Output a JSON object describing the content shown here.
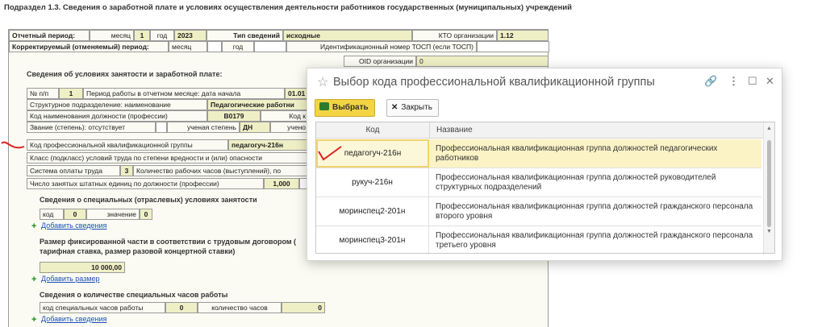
{
  "section_title": "Подраздел 1.3. Сведения о заработной плате и условиях осуществления деятельности работников государственных (муниципальных) учреждений",
  "header": {
    "period_label": "Отчетный период:",
    "month_label": "месяц",
    "month_value": "1",
    "year_label": "год",
    "year_value": "2023",
    "type_label": "Тип сведений",
    "type_value": "исходные",
    "kto_label": "КТО организации",
    "kto_value": "1.12",
    "corr_label": "Корректируемый (отменяемый) период:",
    "corr_month_label": "месяц",
    "corr_year_label": "год",
    "tosp_label": "Идентификационный номер ТОСП (если ТОСП)",
    "oid_label": "OID организации",
    "oid_value": "0"
  },
  "conditions": {
    "heading": "Сведения об условиях занятости и заработной плате:",
    "np_label": "№ п/п",
    "np_value": "1",
    "work_period_label": "Период работы в отчетном месяце:  дата начала",
    "work_period_start": "01.01",
    "struct_label": "Структурное подразделение:  наименование",
    "struct_value": "Педагогические работни",
    "position_code_label": "Код наименования должности (профессии)",
    "position_code_value": "B0179",
    "position_code_tail": "Код к",
    "rank_label": "Звание (степень):  отсутствует",
    "degree_label": "ученая степень",
    "degree_value": "ДН",
    "degree_tail": "учено",
    "pkg_label": "Код профессиональной квалификационной группы",
    "pkg_value": "педагогуч-216н",
    "class_label": "Класс (подкласс) условий труда по степени вредности и (или) опасности",
    "pay_system_label": "Система оплаты труда",
    "pay_system_value": "3",
    "hours_label": "Количество рабочих часов (выступлений), по",
    "staff_units_label": "Число занятых штатных единиц по должности (профессии)",
    "staff_units_value": "1,000"
  },
  "special_conditions": {
    "heading": "Сведения о специальных (отраслевых) условиях занятости",
    "code_label": "код",
    "code_value": "0",
    "value_label": "значение",
    "value_value": "0",
    "add_link": "Добавить сведения"
  },
  "fixed_part": {
    "heading_line1": "Размер фиксированной части в соответствии с трудовым договором (",
    "heading_line2": "тарифная ставка, размер разовой концертной ставки)",
    "value": "10 000,00",
    "add_link": "Добавить размер"
  },
  "special_hours": {
    "heading": "Сведения о количестве специальных часов работы",
    "code_label": "код специальных часов работы",
    "code_value": "0",
    "count_label": "количество часов",
    "count_value": "0",
    "add_link": "Добавить сведения"
  },
  "modal": {
    "title": "Выбор кода профессиональной квалификационной группы",
    "select_button": "Выбрать",
    "close_button": "Закрыть",
    "columns": {
      "code": "Код",
      "name": "Название"
    },
    "rows": [
      {
        "code": "педагогуч-216н",
        "name": "Профессиональная квалификационная группа должностей педагогических работников",
        "selected": true
      },
      {
        "code": "рукуч-216н",
        "name": "Профессиональная квалификационная группа должностей руководителей структурных подразделений",
        "selected": false
      },
      {
        "code": "моринспец2-201н",
        "name": "Профессиональная квалификационная группа должностей гражданского персонала второго уровня",
        "selected": false
      },
      {
        "code": "моринспец3-201н",
        "name": "Профессиональная квалификационная группа должностей гражданского персонала третьего уровня",
        "selected": false
      }
    ]
  },
  "icons": {
    "star": "star-icon",
    "link": "link-icon",
    "menu": "more-vertical-icon",
    "maximize": "maximize-icon",
    "close": "close-icon"
  },
  "colors": {
    "accent_yellow": "#f3d544",
    "selected_row": "#fbf3c6",
    "field_fill": "#efefc6",
    "link_blue": "#1a4fb8",
    "red_mark": "#e02020"
  }
}
